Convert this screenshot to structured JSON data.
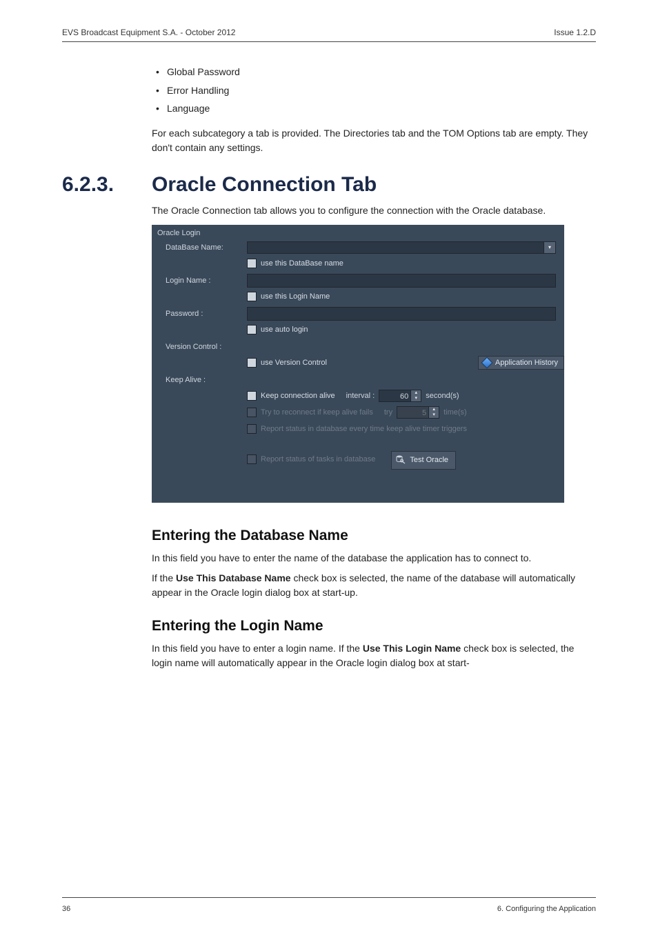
{
  "header": {
    "left": "EVS Broadcast Equipment S.A.  - October 2012",
    "right": "Issue 1.2.D"
  },
  "bullets": {
    "a": "Global Password",
    "b": "Error Handling",
    "c": "Language"
  },
  "para1": "For each subcategory a tab is provided. The Directories tab and the TOM Options tab are empty. They don't contain any settings.",
  "section": {
    "num": "6.2.3.",
    "title": "Oracle Connection Tab"
  },
  "intro": "The Oracle Connection tab allows you to configure the connection with the Oracle database.",
  "shot": {
    "group": "Oracle Login",
    "dbname_lbl": "DataBase Name:",
    "use_db": "use this DataBase name",
    "login_lbl": "Login Name :",
    "use_login": "use this Login Name",
    "pwd_lbl": "Password :",
    "use_auto": "use auto login",
    "version_lbl": "Version Control :",
    "use_version": "use Version Control",
    "apphist": "Application History",
    "keep_lbl": "Keep Alive :",
    "keep_conn": "Keep connection alive",
    "interval_lbl": "interval :",
    "interval_val": "60",
    "interval_unit": "second(s)",
    "try_reconnect": "Try to reconnect if keep alive fails",
    "try_lbl": "try",
    "try_val": "5",
    "try_unit": "time(s)",
    "report_trigger": "Report status in database every time keep alive timer triggers",
    "report_tasks": "Report status of tasks in database",
    "test_btn": "Test Oracle"
  },
  "h2a": "Entering the Database Name",
  "p2": "In this field you have to enter the name of the database the application has to connect to.",
  "p3a": "If the ",
  "p3bold": "Use This Database Name",
  "p3b": " check box is selected, the name of the database will automatically appear in the Oracle login dialog box at start-up.",
  "h2b": "Entering the Login Name",
  "p4a": "In this field you have to enter a login name. If the ",
  "p4bold": "Use This Login Name",
  "p4b": " check box is selected, the login name will automatically appear in the Oracle login dialog box at start-",
  "footer": {
    "left": "36",
    "right": "6. Configuring the Application"
  }
}
